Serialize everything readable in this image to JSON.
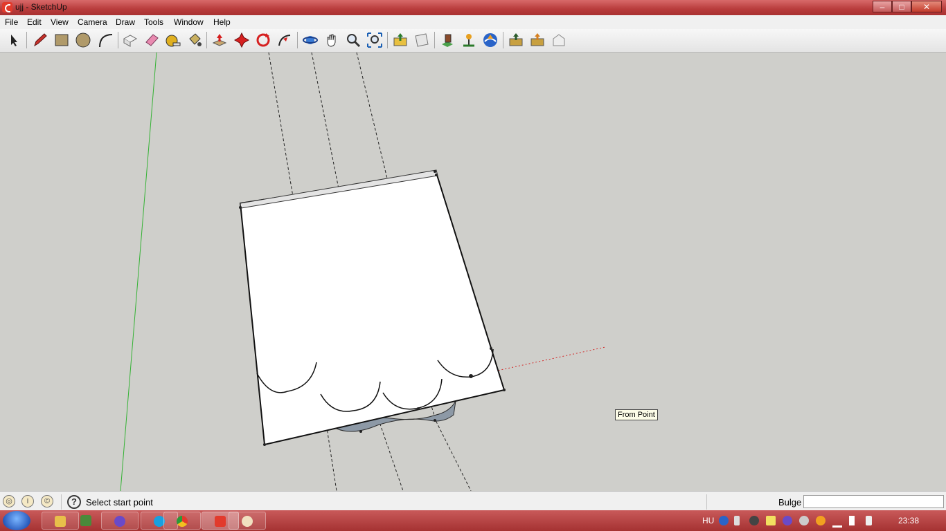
{
  "window": {
    "title": "ujj - SketchUp",
    "min_glyph": "–",
    "max_glyph": "□",
    "close_glyph": "✕"
  },
  "menu": [
    "File",
    "Edit",
    "View",
    "Camera",
    "Draw",
    "Tools",
    "Window",
    "Help"
  ],
  "toolbar_icons": [
    "select-icon",
    "pencil-icon",
    "rectangle-icon",
    "circle-icon",
    "arc-icon",
    "make-component-icon",
    "eraser-icon",
    "tape-measure-icon",
    "paint-bucket-icon",
    "push-pull-icon",
    "move-icon",
    "rotate-icon",
    "follow-me-icon",
    "orbit-icon",
    "pan-icon",
    "zoom-icon",
    "zoom-extents-icon",
    "get-models-icon",
    "share-model-icon",
    "preview-google-earth-icon",
    "add-location-icon",
    "toggle-terrain-icon",
    "get-photo-texture-icon",
    "get-3d-models-icon",
    "share-component-icon",
    "3d-warehouse-icon"
  ],
  "viewport": {
    "tooltip": "From Point"
  },
  "status": {
    "message": "Select start point",
    "vcb_label": "Bulge",
    "vcb_value": "",
    "help_glyph": "?"
  },
  "taskbar": {
    "language": "HU",
    "time": "23:38"
  },
  "colors": {
    "titlebar": "#b83b3b",
    "taskbar": "#a53232",
    "viewport": "#cfcfcb",
    "green_axis": "#33b233",
    "red_axis": "#d22a2a"
  }
}
